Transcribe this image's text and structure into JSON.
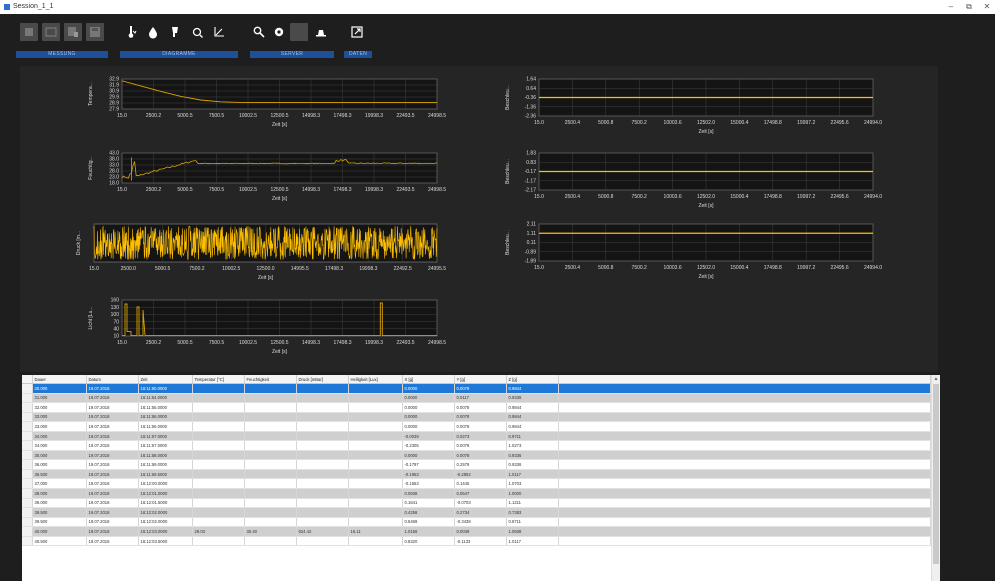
{
  "window": {
    "title": "Session_1_1",
    "controls": [
      "–",
      "⧉",
      "✕"
    ]
  },
  "toolbar": {
    "buttons": [
      {
        "name": "stop",
        "icon": "stop-icon",
        "enabled": false
      },
      {
        "name": "window",
        "icon": "window-icon",
        "enabled": false
      },
      {
        "name": "device",
        "icon": "device-icon",
        "enabled": false
      },
      {
        "name": "save",
        "icon": "save-icon",
        "enabled": false
      },
      {
        "name": "temperature",
        "icon": "thermometer-icon",
        "enabled": true
      },
      {
        "name": "humidity",
        "icon": "droplet-icon",
        "enabled": true
      },
      {
        "name": "pressure",
        "icon": "pressure-icon",
        "enabled": true
      },
      {
        "name": "brightness",
        "icon": "sun-icon",
        "enabled": true
      },
      {
        "name": "acceleration",
        "icon": "axis-icon",
        "enabled": true
      },
      {
        "name": "search",
        "icon": "search-icon",
        "enabled": true
      },
      {
        "name": "settings",
        "icon": "gear-icon",
        "enabled": true
      },
      {
        "name": "empty",
        "icon": "blank-icon",
        "enabled": false
      },
      {
        "name": "hat",
        "icon": "hat-icon",
        "enabled": true
      },
      {
        "name": "export",
        "icon": "export-icon",
        "enabled": true
      }
    ],
    "groups": [
      "MESSUNG",
      "DIAGRAMME",
      "SERVER",
      "DATEN"
    ]
  },
  "charts": {
    "xlabel": "Zeit [s]",
    "left": [
      {
        "ylabel": "Tempera...",
        "yticks": [
          "32.9",
          "31.9",
          "30.9",
          "29.9",
          "28.9",
          "27.9"
        ],
        "xticks": [
          "15.0",
          "2500.2",
          "5000.5",
          "7500.5",
          "10002.5",
          "12500.5",
          "14998.3",
          "17498.3",
          "19998.3",
          "22493.5",
          "24998.5"
        ],
        "ylim": [
          27.9,
          32.9
        ],
        "series": {
          "name": "Temperatur",
          "color": "#d9a400",
          "shape": "temperature",
          "values_approx": [
            32.6,
            31.7,
            30.8,
            30.0,
            29.4,
            29.1,
            29.0,
            29.0,
            29.0,
            29.0,
            29.0,
            29.0,
            29.0,
            29.0,
            29.0,
            29.0,
            29.0
          ]
        }
      },
      {
        "ylabel": "Feuchtig...",
        "yticks": [
          "43.0",
          "38.0",
          "33.0",
          "28.0",
          "23.0",
          "18.0"
        ],
        "xticks": [
          "15.0",
          "2500.2",
          "5000.5",
          "7500.5",
          "10002.5",
          "12500.5",
          "14998.3",
          "17498.3",
          "19998.3",
          "22493.5",
          "24998.5"
        ],
        "ylim": [
          18.0,
          43.0
        ],
        "series": {
          "name": "Feuchtigkeit",
          "color": "#d9a400",
          "shape": "humidity"
        }
      },
      {
        "ylabel": "Druck [m...",
        "yticks": [],
        "xticks": [
          "15.0",
          "2500.0",
          "5000.5",
          "7500.2",
          "10002.5",
          "12500.0",
          "14995.5",
          "17498.3",
          "19998.3",
          "22492.5",
          "24995.5"
        ],
        "series": {
          "name": "Druck",
          "color": "#ffc000",
          "shape": "noise"
        }
      },
      {
        "ylabel": "Licht [Lu...",
        "yticks": [
          "160",
          "130",
          "100",
          "70",
          "40",
          "10"
        ],
        "xticks": [
          "15.0",
          "2500.2",
          "5000.5",
          "7500.5",
          "10002.5",
          "12500.5",
          "14998.3",
          "17498.3",
          "19998.3",
          "22493.5",
          "24998.5"
        ],
        "ylim": [
          10,
          160
        ],
        "series": {
          "name": "Licht",
          "color": "#d9a400",
          "shape": "light"
        }
      }
    ],
    "right": [
      {
        "ylabel": "Beschleu...",
        "yticks": [
          "1.64",
          "0.64",
          "-0.36",
          "-1.36",
          "-2.36"
        ],
        "xticks": [
          "15.0",
          "2500.4",
          "5000.8",
          "7500.2",
          "10003.6",
          "12502.0",
          "15000.4",
          "17498.8",
          "19997.2",
          "22495.6",
          "24994.0"
        ],
        "ylim": [
          -2.36,
          1.64
        ],
        "series": {
          "name": "Beschleunigung X",
          "color": "#ffc000",
          "value": -0.36
        }
      },
      {
        "ylabel": "Beschleu...",
        "yticks": [
          "1.83",
          "0.83",
          "-0.17",
          "-1.17",
          "-2.17"
        ],
        "xticks": [
          "15.0",
          "2500.4",
          "5000.8",
          "7500.2",
          "10003.6",
          "12502.0",
          "15000.4",
          "17498.8",
          "19997.2",
          "22495.6",
          "24994.0"
        ],
        "ylim": [
          -2.17,
          1.83
        ],
        "series": {
          "name": "Beschleunigung Y",
          "color": "#ffc000",
          "value": -0.17
        }
      },
      {
        "ylabel": "Beschleu...",
        "yticks": [
          "2.11",
          "1.11",
          "0.11",
          "-0.89",
          "-1.89"
        ],
        "xticks": [
          "15.0",
          "2500.4",
          "5000.8",
          "7500.2",
          "10003.6",
          "12502.0",
          "15000.4",
          "17498.8",
          "19997.2",
          "22495.6",
          "24994.0"
        ],
        "ylim": [
          -1.89,
          2.11
        ],
        "series": {
          "name": "Beschleunigung Z",
          "color": "#ffc000",
          "value": 1.11
        }
      }
    ]
  },
  "grid": {
    "columns": [
      "Dauer",
      "Datum",
      "Zeit",
      "Temperatur [°C]",
      "Feuchtigkeit",
      "Druck [mBar]",
      "Helligkeit [Lux]",
      "X [g]",
      "Y [g]",
      "Z [g]"
    ],
    "selected_row": 0,
    "rows": [
      [
        "30.000",
        "19.07.2018",
        "16:11:50.0000",
        "",
        "",
        "",
        "",
        "0.0000",
        "0.0078",
        "0.9844"
      ],
      [
        "31.000",
        "19.07.2018",
        "16:11:54.0000",
        "",
        "",
        "",
        "",
        "0.0000",
        "0.0117",
        "0.9336"
      ],
      [
        "32.000",
        "19.07.2018",
        "16:11:55.0000",
        "",
        "",
        "",
        "",
        "0.0000",
        "0.0078",
        "0.9844"
      ],
      [
        "33.000",
        "19.07.2018",
        "16:11:56.0000",
        "",
        "",
        "",
        "",
        "0.0000",
        "0.0078",
        "0.9844"
      ],
      [
        "33.000",
        "19.07.2018",
        "16:11:56.0000",
        "",
        "",
        "",
        "",
        "0.0000",
        "0.0078",
        "0.9844"
      ],
      [
        "34.000",
        "19.07.2018",
        "16:11:57.0000",
        "",
        "",
        "",
        "",
        "-0.0039",
        "0.0273",
        "0.9711"
      ],
      [
        "34.000",
        "19.07.2018",
        "16:11:57.0000",
        "",
        "",
        "",
        "",
        "-0.2305",
        "0.0078",
        "1.0273"
      ],
      [
        "35.000",
        "19.07.2018",
        "16:11:58.0000",
        "",
        "",
        "",
        "",
        "0.0000",
        "0.0078",
        "0.9336"
      ],
      [
        "36.000",
        "19.07.2018",
        "16:11:59.0000",
        "",
        "",
        "",
        "",
        "-0.1797",
        "0.2578",
        "0.9336"
      ],
      [
        "36.500",
        "19.07.2018",
        "16:11:59.5000",
        "",
        "",
        "",
        "",
        "-0.1953",
        "-0.2852",
        "1.0117"
      ],
      [
        "37.000",
        "19.07.2018",
        "16:12:00.0000",
        "",
        "",
        "",
        "",
        "-0.1563",
        "0.1445",
        "1.0703"
      ],
      [
        "38.000",
        "19.07.2018",
        "16:12:01.0000",
        "",
        "",
        "",
        "",
        "0.0938",
        "0.0547",
        "1.0000"
      ],
      [
        "39.000",
        "19.07.2018",
        "16:12:01.5000",
        "",
        "",
        "",
        "",
        "0.1641",
        "-0.0703",
        "1.1211"
      ],
      [
        "39.500",
        "19.07.2018",
        "16:12:02.0000",
        "",
        "",
        "",
        "",
        "0.4258",
        "0.2734",
        "0.7383"
      ],
      [
        "39.500",
        "19.07.2018",
        "16:12:02.0000",
        "",
        "",
        "",
        "",
        "0.5469",
        "-0.3438",
        "0.8711"
      ],
      [
        "40.000",
        "19.07.2018",
        "16:12:03.0000",
        "29.03",
        "30.40",
        "924.42",
        "16.11",
        "1.0156",
        "0.0039",
        "1.0938"
      ],
      [
        "40.500",
        "19.07.2018",
        "16:12:03.5000",
        "",
        "",
        "",
        "",
        "0.8320",
        "-0.1133",
        "1.0117"
      ]
    ]
  }
}
